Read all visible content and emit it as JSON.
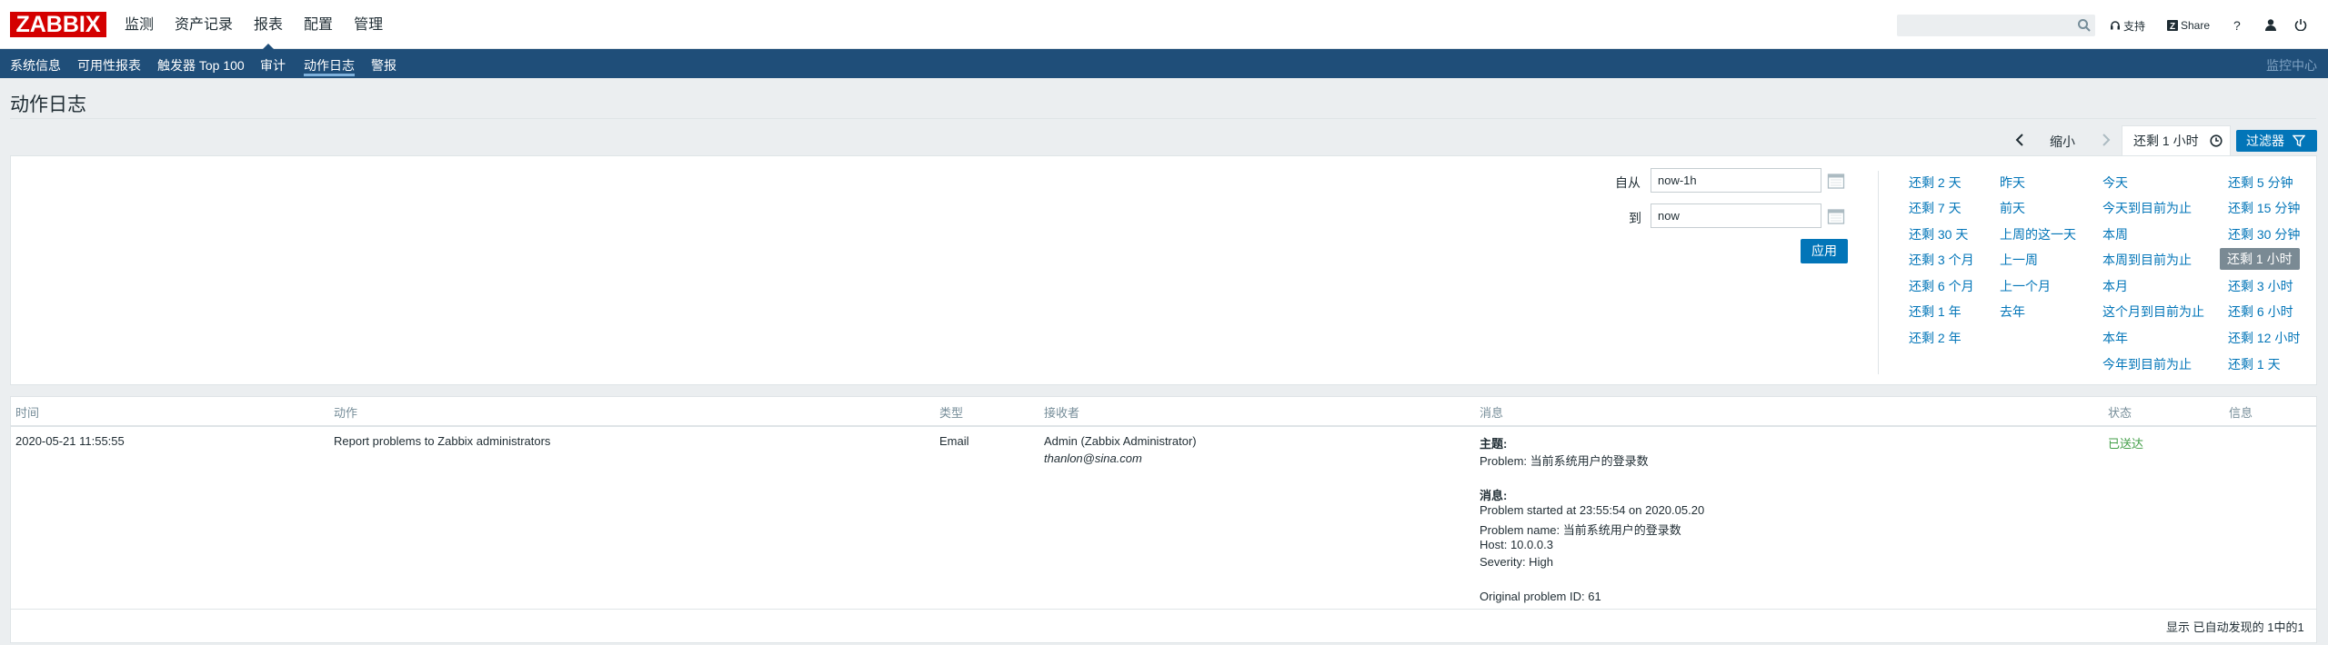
{
  "header": {
    "logo": "ZABBIX",
    "menu": [
      "监测",
      "资产记录",
      "报表",
      "配置",
      "管理"
    ],
    "selected_menu": 2,
    "support": "支持",
    "share": "Share",
    "help": "?",
    "search_placeholder": ""
  },
  "subnav": {
    "items": [
      "系统信息",
      "可用性报表",
      "触发器 Top 100",
      "审计",
      "动作日志",
      "警报"
    ],
    "selected": 4,
    "right": "监控中心"
  },
  "page": {
    "title": "动作日志"
  },
  "timenav": {
    "zoom_out": "缩小",
    "current_tab": "还剩 1 小时",
    "filter_button": "过滤器"
  },
  "filter": {
    "from_label": "自从",
    "from_value": "now-1h",
    "to_label": "到",
    "to_value": "now",
    "apply": "应用",
    "quick": {
      "col1": [
        "还剩 2 天",
        "还剩 7 天",
        "还剩 30 天",
        "还剩 3 个月",
        "还剩 6 个月",
        "还剩 1 年",
        "还剩 2 年"
      ],
      "col2": [
        "昨天",
        "前天",
        "上周的这一天",
        "上一周",
        "上一个月",
        "去年"
      ],
      "col3": [
        "今天",
        "今天到目前为止",
        "本周",
        "本周到目前为止",
        "本月",
        "这个月到目前为止",
        "本年",
        "今年到目前为止"
      ],
      "col4": [
        "还剩 5 分钟",
        "还剩 15 分钟",
        "还剩 30 分钟",
        "还剩 1 小时",
        "还剩 3 小时",
        "还剩 6 小时",
        "还剩 12 小时",
        "还剩 1 天"
      ]
    },
    "selected_quick": "还剩 1 小时"
  },
  "table": {
    "headers": [
      "时间",
      "动作",
      "类型",
      "接收者",
      "消息",
      "状态",
      "信息"
    ],
    "row": {
      "time": "2020-05-21 11:55:55",
      "action": "Report problems to Zabbix administrators",
      "type": "Email",
      "recipient_name": "Admin (Zabbix Administrator)",
      "recipient_email": "thanlon@sina.com",
      "subject_label": "主题:",
      "subject": "Problem: 当前系统用户的登录数",
      "message_label": "消息:",
      "message_lines": [
        "Problem started at 23:55:54 on 2020.05.20",
        "Problem name: 当前系统用户的登录数",
        "Host: 10.0.0.3",
        "Severity: High",
        "",
        "Original problem ID: 61"
      ],
      "status": "已送达",
      "info": ""
    },
    "footer": "显示 已自动发现的 1中的1"
  },
  "colors": {
    "navy": "#1f4e79",
    "link": "#0275b8",
    "sent": "#429e47",
    "logo": "#d40000"
  }
}
